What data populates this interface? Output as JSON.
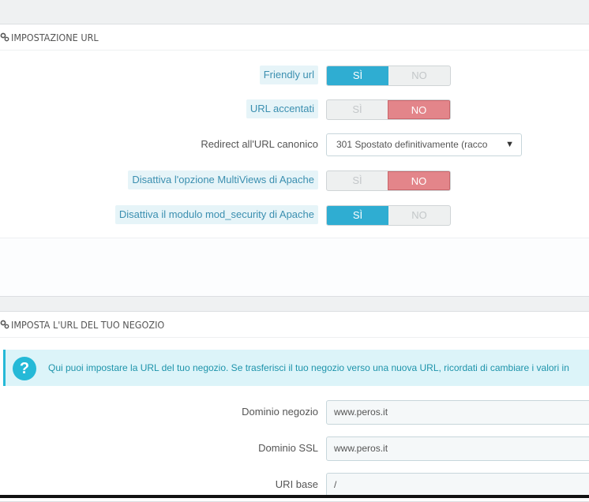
{
  "section_url": {
    "title": "IMPOSTAZIONE URL",
    "friendly_url": {
      "label": "Friendly url",
      "yes": "SÌ",
      "no": "NO",
      "value": "yes"
    },
    "accented_url": {
      "label": "URL accentati",
      "yes": "SÌ",
      "no": "NO",
      "value": "no"
    },
    "canonical_redirect": {
      "label": "Redirect all'URL canonico",
      "selected": "301 Spostato definitivamente (racco"
    },
    "multiviews": {
      "label": "Disattiva l'opzione MultiViews di Apache",
      "yes": "SÌ",
      "no": "NO",
      "value": "no"
    },
    "mod_security": {
      "label": "Disattiva il modulo mod_security di Apache",
      "yes": "SÌ",
      "no": "NO",
      "value": "yes"
    }
  },
  "section_shop_url": {
    "title": "IMPOSTA L'URL DEL TUO NEGOZIO",
    "info_text": "Qui puoi impostare la URL del tuo negozio. Se trasferisci il tuo negozio verso una nuova URL, ricordati di cambiare i valori in",
    "info_icon": "?",
    "shop_domain": {
      "label": "Dominio negozio",
      "value": "www.peros.it"
    },
    "ssl_domain": {
      "label": "Dominio SSL",
      "value": "www.peros.it"
    },
    "base_uri": {
      "label": "URI base",
      "value": "/"
    }
  },
  "colors": {
    "accent": "#2fadd2",
    "danger": "#e3858a",
    "info_bg": "#dcf4f9"
  }
}
